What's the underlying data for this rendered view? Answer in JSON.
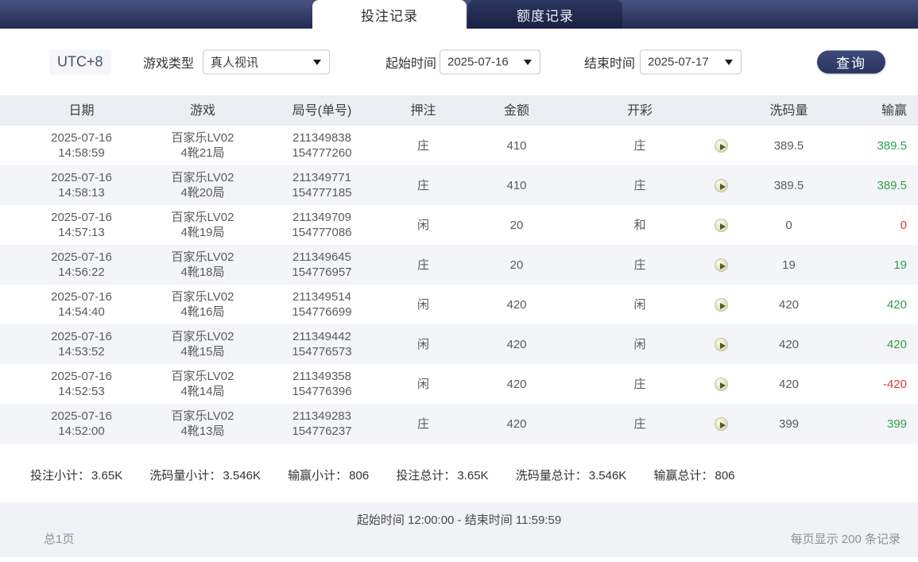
{
  "tabs": {
    "bet_records": "投注记录",
    "quota_records": "额度记录"
  },
  "filters": {
    "timezone": "UTC+8",
    "game_type_label": "游戏类型",
    "game_type_value": "真人视讯",
    "start_time_label": "起始时间",
    "start_time_value": "2025-07-16",
    "end_time_label": "结束时间",
    "end_time_value": "2025-07-17",
    "query_button": "查询"
  },
  "table": {
    "headers": [
      "日期",
      "游戏",
      "局号(单号)",
      "押注",
      "金额",
      "开彩",
      "",
      "洗码量",
      "输赢"
    ],
    "rows": [
      {
        "date": "2025-07-16",
        "time": "14:58:59",
        "game_name": "百家乐LV02",
        "game_round": "4靴21局",
        "round_no": "211349838",
        "order_no": "154777260",
        "bet": "庄",
        "amount": "410",
        "result": "庄",
        "rolling": "389.5",
        "winloss": "389.5",
        "tone": "green"
      },
      {
        "date": "2025-07-16",
        "time": "14:58:13",
        "game_name": "百家乐LV02",
        "game_round": "4靴20局",
        "round_no": "211349771",
        "order_no": "154777185",
        "bet": "庄",
        "amount": "410",
        "result": "庄",
        "rolling": "389.5",
        "winloss": "389.5",
        "tone": "green"
      },
      {
        "date": "2025-07-16",
        "time": "14:57:13",
        "game_name": "百家乐LV02",
        "game_round": "4靴19局",
        "round_no": "211349709",
        "order_no": "154777086",
        "bet": "闲",
        "amount": "20",
        "result": "和",
        "rolling": "0",
        "winloss": "0",
        "tone": "red"
      },
      {
        "date": "2025-07-16",
        "time": "14:56:22",
        "game_name": "百家乐LV02",
        "game_round": "4靴18局",
        "round_no": "211349645",
        "order_no": "154776957",
        "bet": "庄",
        "amount": "20",
        "result": "庄",
        "rolling": "19",
        "winloss": "19",
        "tone": "green"
      },
      {
        "date": "2025-07-16",
        "time": "14:54:40",
        "game_name": "百家乐LV02",
        "game_round": "4靴16局",
        "round_no": "211349514",
        "order_no": "154776699",
        "bet": "闲",
        "amount": "420",
        "result": "闲",
        "rolling": "420",
        "winloss": "420",
        "tone": "green"
      },
      {
        "date": "2025-07-16",
        "time": "14:53:52",
        "game_name": "百家乐LV02",
        "game_round": "4靴15局",
        "round_no": "211349442",
        "order_no": "154776573",
        "bet": "闲",
        "amount": "420",
        "result": "闲",
        "rolling": "420",
        "winloss": "420",
        "tone": "green"
      },
      {
        "date": "2025-07-16",
        "time": "14:52:53",
        "game_name": "百家乐LV02",
        "game_round": "4靴14局",
        "round_no": "211349358",
        "order_no": "154776396",
        "bet": "闲",
        "amount": "420",
        "result": "庄",
        "rolling": "420",
        "winloss": "-420",
        "tone": "red"
      },
      {
        "date": "2025-07-16",
        "time": "14:52:00",
        "game_name": "百家乐LV02",
        "game_round": "4靴13局",
        "round_no": "211349283",
        "order_no": "154776237",
        "bet": "庄",
        "amount": "420",
        "result": "庄",
        "rolling": "399",
        "winloss": "399",
        "tone": "green"
      }
    ]
  },
  "summary": {
    "items": [
      {
        "label": "投注小计：",
        "value": "3.65K"
      },
      {
        "label": "洗码量小计：",
        "value": "3.546K"
      },
      {
        "label": "输赢小计：",
        "value": "806"
      },
      {
        "label": "投注总计：",
        "value": "3.65K"
      },
      {
        "label": "洗码量总计：",
        "value": "3.546K"
      },
      {
        "label": "输赢总计：",
        "value": "806"
      }
    ]
  },
  "footer": {
    "time_range": "起始时间 12:00:00 - 结束时间 11:59:59",
    "page_info": "总1页",
    "per_page_info": "每页显示 200 条记录"
  },
  "colors": {
    "accent_navy": "#2b3560",
    "win_green": "#2e9e4e",
    "loss_red": "#e23b3b",
    "header_bg": "#eceef3",
    "stripe_bg": "#f4f5f9"
  }
}
